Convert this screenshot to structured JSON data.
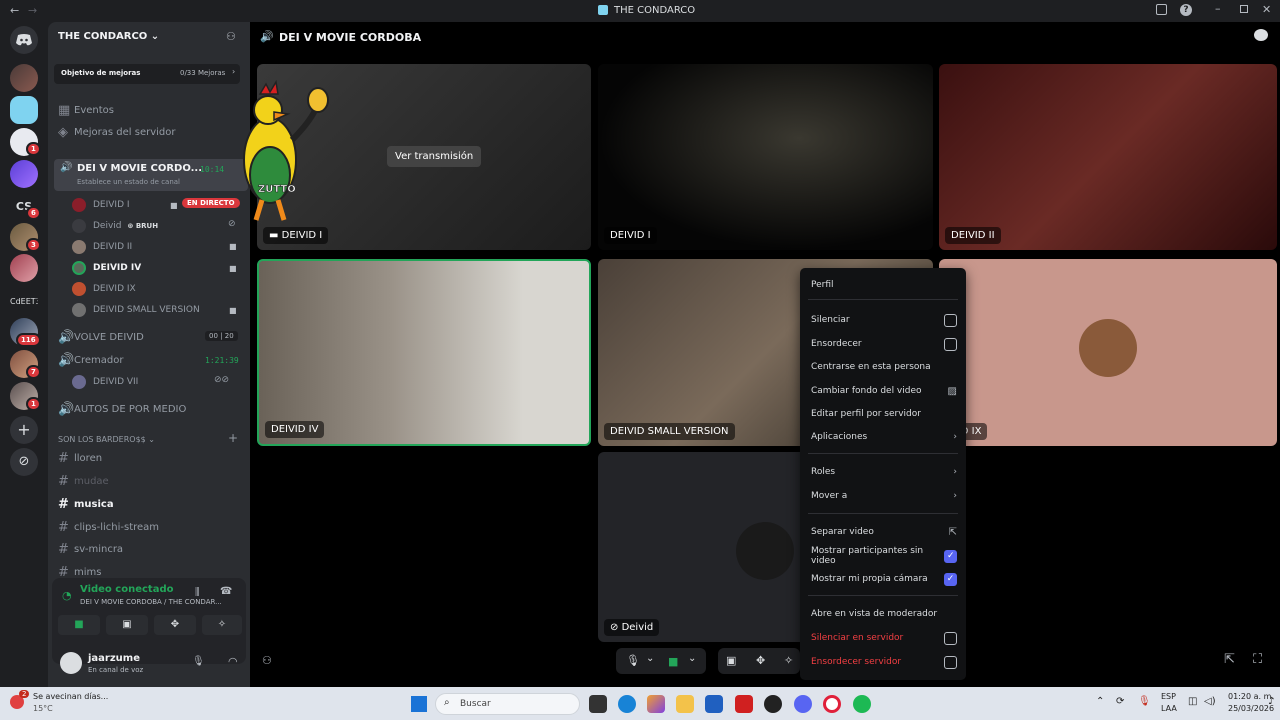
{
  "window": {
    "title": "THE CONDARCO"
  },
  "server": {
    "name": "THE CONDARCO"
  },
  "boost": {
    "label": "Objetivo de mejoras",
    "progress": "0/33 Mejoras"
  },
  "sidebar_top": [
    {
      "label": "Eventos",
      "icon": "calendar-icon"
    },
    {
      "label": "Mejoras del servidor",
      "icon": "boost-gem-icon"
    }
  ],
  "active_voice": {
    "name": "DEI V MOVIE CORDO...",
    "time": "10:14",
    "status": "Establece un estado de canal"
  },
  "voice_users": [
    {
      "name": "DEIVID I",
      "live": "EN DIRECTO"
    },
    {
      "name": "Deivid",
      "tag": "BRUH"
    },
    {
      "name": "DEIVID II"
    },
    {
      "name": "DEIVID IV"
    },
    {
      "name": "DEIVID IX"
    },
    {
      "name": "DEIVID SMALL VERSION"
    }
  ],
  "voice_channels": [
    {
      "name": "VOLVE DEIVID",
      "count_a": "00",
      "count_b": "20"
    },
    {
      "name": "Cremador",
      "time": "1:21:39"
    }
  ],
  "cremador_user": "DEIVID VII",
  "voice_channel_3": "AUTOS DE POR MEDIO",
  "category": "SON LOS BARDERO$$",
  "text_channels": [
    "lloren",
    "mudae",
    "musica",
    "clips-lichi-stream",
    "sv-mincra",
    "mims"
  ],
  "guild_labels": {
    "cs": "CS",
    "cdeet": "CdEET3"
  },
  "guild_badges": [
    "1",
    "6",
    "3",
    "116",
    "7",
    "1"
  ],
  "voice_panel": {
    "status": "Video conectado",
    "channel": "DEI V MOVIE CORDOBA / THE CONDAR..."
  },
  "user": {
    "name": "jaarzume",
    "status": "En canal de voz"
  },
  "main": {
    "channel_title": "DEI V MOVIE CORDOBA"
  },
  "tiles": {
    "stream_name": "DEIVID I",
    "stream_button": "Ver transmisión",
    "t2": "DEIVID I",
    "t3": "DEIVID II",
    "t4": "DEIVID IV",
    "t5": "DEIVID SMALL VERSION",
    "t6": "VID IX",
    "t7": "Deivid"
  },
  "menu": {
    "perfil": "Perfil",
    "silenciar": "Silenciar",
    "ensordecer": "Ensordecer",
    "centrarse": "Centrarse en esta persona",
    "fondo": "Cambiar fondo del video",
    "editar": "Editar perfil por servidor",
    "aplicaciones": "Aplicaciones",
    "roles": "Roles",
    "mover": "Mover a",
    "separar": "Separar video",
    "mostrar_part": "Mostrar participantes sin video",
    "mostrar_cam": "Mostrar mi propia cámara",
    "moderador": "Abre en vista de moderador",
    "silenciar_srv": "Silenciar en servidor",
    "ensordecer_srv": "Ensordecer servidor"
  },
  "taskbar": {
    "weather": "Se avecinan días...",
    "temp": "15°C",
    "weather_badge": "2",
    "search": "Buscar",
    "lang": "ESP",
    "lang2": "LAA",
    "time": "01:20 a. m.",
    "date": "25/03/2026"
  },
  "colors": {
    "accent": "#5865f2",
    "green": "#23a559",
    "red": "#da373c"
  }
}
